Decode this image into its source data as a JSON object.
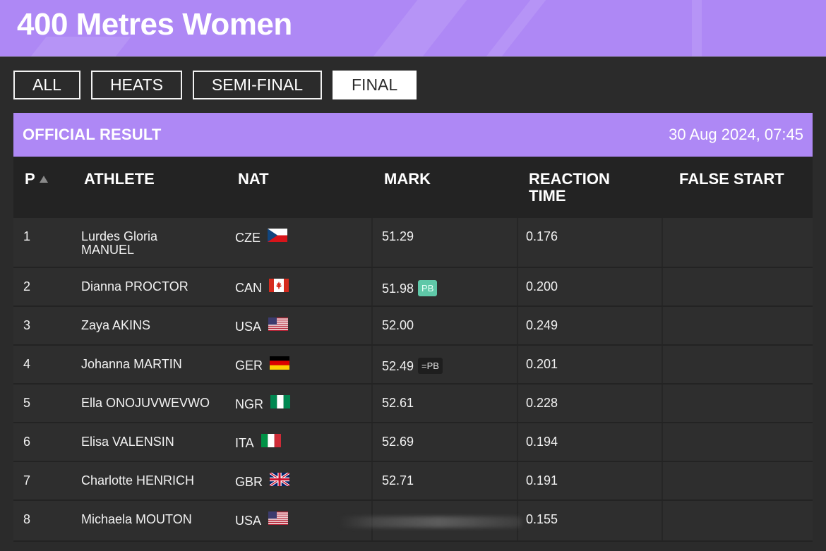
{
  "event_title": "400 Metres Women",
  "tabs": [
    {
      "label": "ALL",
      "active": false
    },
    {
      "label": "HEATS",
      "active": false
    },
    {
      "label": "SEMI-FINAL",
      "active": false
    },
    {
      "label": "FINAL",
      "active": true
    }
  ],
  "result_bar": {
    "label": "OFFICIAL RESULT",
    "datetime": "30 Aug 2024, 07:45"
  },
  "columns": {
    "place": "P",
    "athlete": "ATHLETE",
    "nat": "NAT",
    "mark": "MARK",
    "reaction_line1": "REACTION",
    "reaction_line2": "TIME",
    "false_start": "FALSE START"
  },
  "rows": [
    {
      "place": "1",
      "name_line1": "Lurdes Gloria",
      "name_line2": "MANUEL",
      "nat": "CZE",
      "flag": "cze-flag",
      "mark": "51.29",
      "badge": "",
      "reaction": "0.176"
    },
    {
      "place": "2",
      "name_line1": "Dianna PROCTOR",
      "name_line2": "",
      "nat": "CAN",
      "flag": "can-flag",
      "mark": "51.98",
      "badge": "PB",
      "reaction": "0.200"
    },
    {
      "place": "3",
      "name_line1": "Zaya AKINS",
      "name_line2": "",
      "nat": "USA",
      "flag": "usa-flag",
      "mark": "52.00",
      "badge": "",
      "reaction": "0.249"
    },
    {
      "place": "4",
      "name_line1": "Johanna MARTIN",
      "name_line2": "",
      "nat": "GER",
      "flag": "ger-flag",
      "mark": "52.49",
      "badge": "=PB",
      "reaction": "0.201"
    },
    {
      "place": "5",
      "name_line1": "Ella ONOJUVWEVWO",
      "name_line2": "",
      "nat": "NGR",
      "flag": "ngr-flag",
      "mark": "52.61",
      "badge": "",
      "reaction": "0.228"
    },
    {
      "place": "6",
      "name_line1": "Elisa VALENSIN",
      "name_line2": "",
      "nat": "ITA",
      "flag": "ita-flag",
      "mark": "52.69",
      "badge": "",
      "reaction": "0.194"
    },
    {
      "place": "7",
      "name_line1": "Charlotte HENRICH",
      "name_line2": "",
      "nat": "GBR",
      "flag": "gbr-flag",
      "mark": "52.71",
      "badge": "",
      "reaction": "0.191"
    },
    {
      "place": "8",
      "name_line1": "Michaela MOUTON",
      "name_line2": "",
      "nat": "USA",
      "flag": "usa-flag",
      "mark": "",
      "badge": "",
      "reaction": "0.155"
    }
  ],
  "colors": {
    "accent": "#ae88f5",
    "pb_badge": "#5fc8a8",
    "background": "#2b2b2b"
  }
}
